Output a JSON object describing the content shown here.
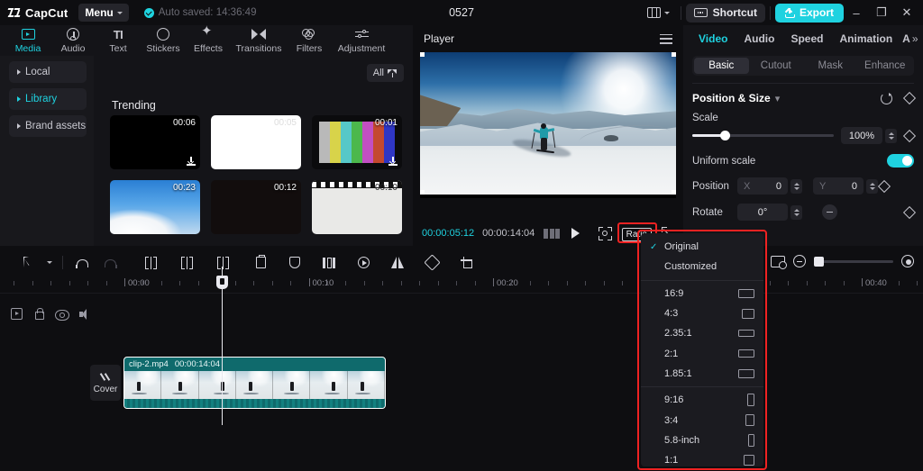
{
  "titlebar": {
    "app_name": "CapCut",
    "menu_label": "Menu",
    "autosave_text": "Auto saved: 14:36:49",
    "project_title": "0527",
    "shortcut_label": "Shortcut",
    "export_label": "Export",
    "minimize": "–",
    "maximize": "❐",
    "close": "✕",
    "accent_color": "#1fd2e0"
  },
  "tabs": [
    {
      "label": "Media",
      "icon": "media-icon",
      "active": true
    },
    {
      "label": "Audio",
      "icon": "audio-icon",
      "active": false
    },
    {
      "label": "Text",
      "icon": "text-icon",
      "active": false
    },
    {
      "label": "Stickers",
      "icon": "sticker-icon",
      "active": false
    },
    {
      "label": "Effects",
      "icon": "effects-icon",
      "active": false
    },
    {
      "label": "Transitions",
      "icon": "transitions-icon",
      "active": false
    },
    {
      "label": "Filters",
      "icon": "filters-icon",
      "active": false
    },
    {
      "label": "Adjustment",
      "icon": "adjustment-icon",
      "active": false
    }
  ],
  "media_panel": {
    "nav": [
      {
        "label": "Local",
        "active": false
      },
      {
        "label": "Library",
        "active": true
      },
      {
        "label": "Brand assets",
        "active": false
      }
    ],
    "filter_label": "All",
    "section_title": "Trending",
    "items": [
      {
        "duration": "00:06",
        "style": "t-black",
        "download": true
      },
      {
        "duration": "00:05",
        "style": "t-white",
        "download": false
      },
      {
        "duration": "00:01",
        "style": "t-bars",
        "download": true
      },
      {
        "duration": "00:23",
        "style": "t-sky",
        "download": false
      },
      {
        "duration": "00:12",
        "style": "t-dark",
        "download": false
      },
      {
        "duration": "00:10",
        "style": "t-film",
        "download": false
      }
    ]
  },
  "player": {
    "title": "Player",
    "current_time": "00:00:05:12",
    "total_time": "00:00:14:04",
    "ratio_label": "Ratio",
    "highlight_color": "#ef2222"
  },
  "ratio_menu": {
    "selected": "Original",
    "items": [
      {
        "label": "Original",
        "checked": true,
        "shape": null
      },
      {
        "label": "Customized",
        "checked": false,
        "shape": null
      },
      {
        "label": "16:9",
        "checked": false,
        "shape": "w18h10"
      },
      {
        "label": "4:3",
        "checked": false,
        "shape": "w14h11"
      },
      {
        "label": "2.35:1",
        "checked": false,
        "shape": "w18h8"
      },
      {
        "label": "2:1",
        "checked": false,
        "shape": "w18h9"
      },
      {
        "label": "1.85:1",
        "checked": false,
        "shape": "w18h10"
      },
      {
        "label": "9:16",
        "checked": false,
        "shape": "w8h14"
      },
      {
        "label": "3:4",
        "checked": false,
        "shape": "w10h13"
      },
      {
        "label": "5.8-inch",
        "checked": false,
        "shape": "w7h14"
      },
      {
        "label": "1:1",
        "checked": false,
        "shape": "w12h12"
      }
    ]
  },
  "right_panel": {
    "tabs": [
      {
        "label": "Video",
        "active": true
      },
      {
        "label": "Audio",
        "active": false
      },
      {
        "label": "Speed",
        "active": false
      },
      {
        "label": "Animation",
        "active": false
      },
      {
        "label": "A",
        "active": false
      }
    ],
    "more_icon": "»",
    "subtabs": [
      {
        "label": "Basic",
        "active": true
      },
      {
        "label": "Cutout",
        "active": false
      },
      {
        "label": "Mask",
        "active": false
      },
      {
        "label": "Enhance",
        "active": false
      }
    ],
    "section_title": "Position & Size",
    "scale_label": "Scale",
    "scale_value": "100%",
    "uniform_label": "Uniform scale",
    "uniform_on": true,
    "position_label": "Position",
    "position_x_axis": "X",
    "position_x_value": "0",
    "position_y_axis": "Y",
    "position_y_value": "0",
    "rotate_label": "Rotate",
    "rotate_value": "0°"
  },
  "timeline": {
    "ruler_labels": [
      "00:00",
      "00:10",
      "00:20",
      "00:40"
    ],
    "clip": {
      "name": "clip-2.mp4",
      "duration": "00:00:14:04"
    },
    "cover_label": "Cover",
    "track_icons": [
      "video-icon",
      "lock-icon",
      "eye-icon",
      "speaker-icon"
    ]
  }
}
